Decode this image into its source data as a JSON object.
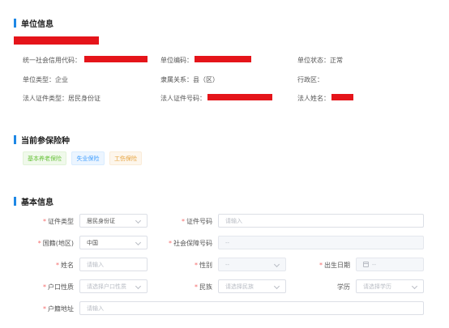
{
  "unit_info": {
    "title": "单位信息",
    "credit_code_label": "统一社会信用代码：",
    "unit_code_label": "单位编码：",
    "status_label": "单位状态：",
    "status_value": "正常",
    "type_label": "单位类型：",
    "type_value": "企业",
    "affiliation_label": "隶属关系：",
    "affiliation_value": "县（区）",
    "district_label": "行政区：",
    "legal_id_type_label": "法人证件类型：",
    "legal_id_type_value": "居民身份证",
    "legal_id_no_label": "法人证件号码：",
    "legal_name_label": "法人姓名："
  },
  "insurance": {
    "title": "当前参保险种",
    "tags": [
      "基本养老保险",
      "失业保险",
      "工伤保险"
    ],
    "colors": {
      "green": "#67c23a",
      "blue": "#409eff",
      "orange": "#e6a23c"
    }
  },
  "basic_info": {
    "title": "基本信息",
    "id_type_label": "证件类型",
    "id_type_value": "居民身份证",
    "id_no_label": "证件号码",
    "id_no_placeholder": "请输入",
    "nationality_label": "国籍(地区)",
    "nationality_value": "中国",
    "ss_no_label": "社会保障号码",
    "ss_no_value": "--",
    "name_label": "姓名",
    "name_placeholder": "请输入",
    "gender_label": "性别",
    "gender_value": "--",
    "birth_label": "出生日期",
    "birth_value": "--",
    "hukou_type_label": "户口性质",
    "hukou_type_placeholder": "请选择户口性质",
    "ethnicity_label": "民族",
    "ethnicity_placeholder": "请选择民族",
    "education_label": "学历",
    "education_placeholder": "请选择学历",
    "address_label": "户籍地址",
    "address_placeholder": "请输入",
    "required_mark": "*"
  },
  "colors": {
    "accent": "#1e88e5",
    "redaction": "#e5141a",
    "required": "#f56c6c"
  }
}
